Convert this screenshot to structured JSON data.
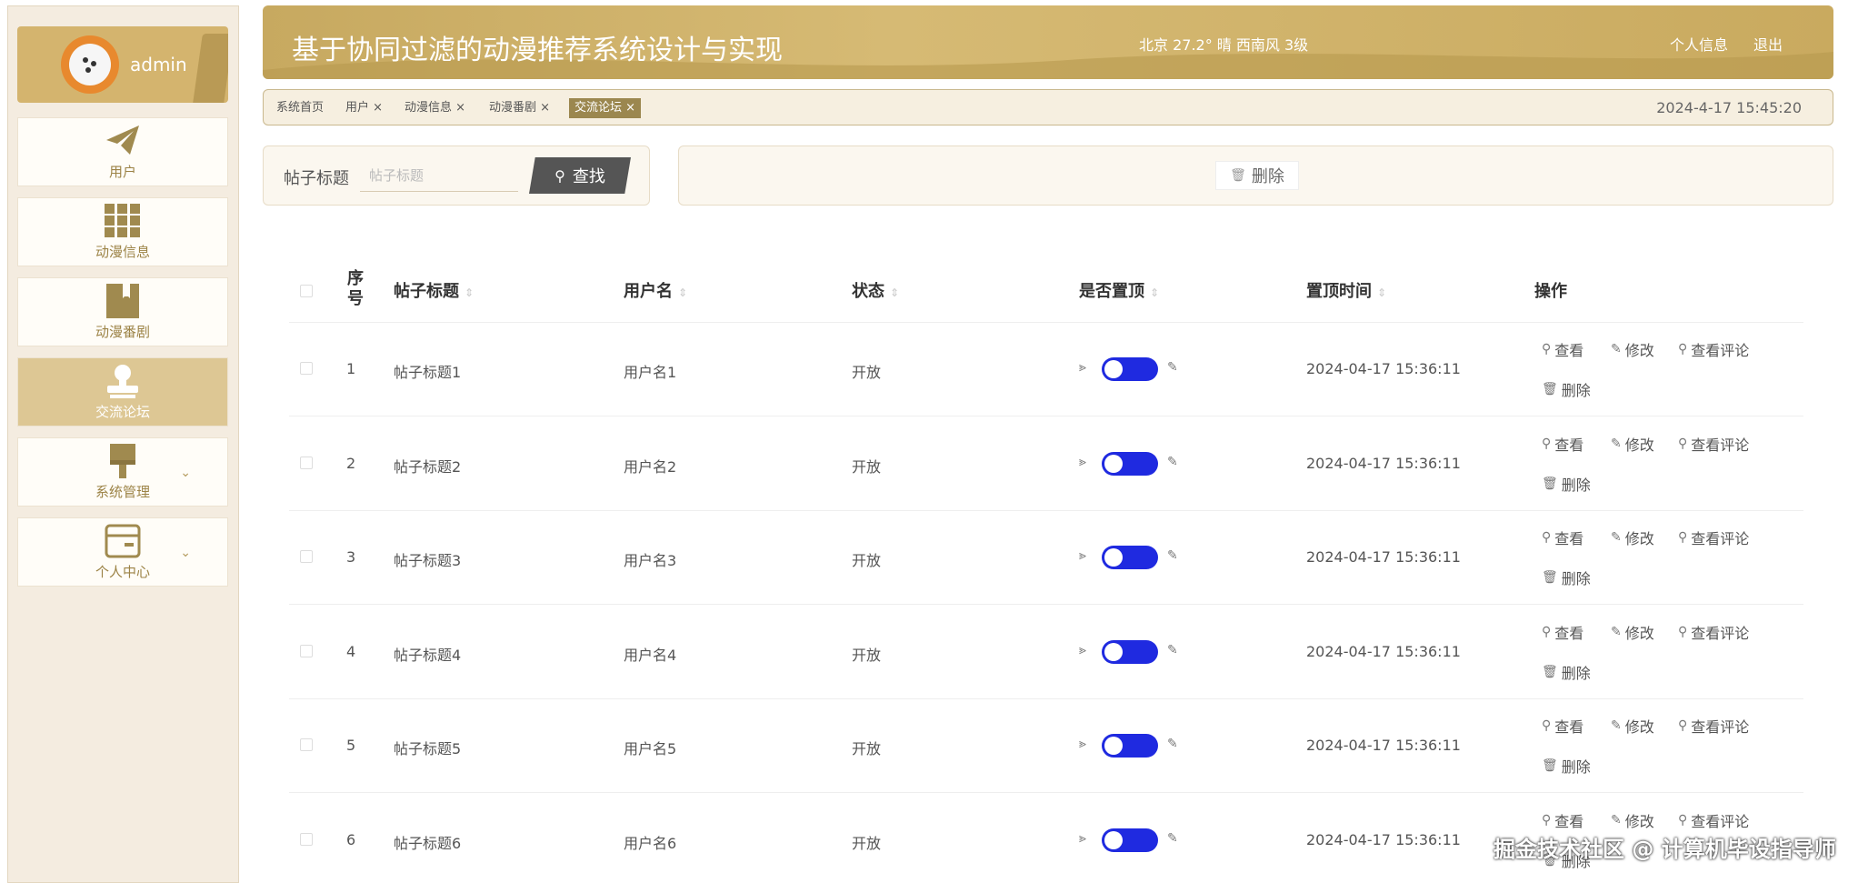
{
  "user": {
    "name": "admin"
  },
  "sidebar": {
    "items": [
      {
        "label": "用户",
        "icon": "paper-plane-icon"
      },
      {
        "label": "动漫信息",
        "icon": "grid-icon"
      },
      {
        "label": "动漫番剧",
        "icon": "book-icon"
      },
      {
        "label": "交流论坛",
        "icon": "stamp-icon",
        "active": true
      },
      {
        "label": "系统管理",
        "icon": "brush-icon"
      },
      {
        "label": "个人中心",
        "icon": "wallet-icon"
      }
    ]
  },
  "header": {
    "title": "基于协同过滤的动漫推荐系统设计与实现",
    "weather": "北京  27.2°  晴  西南风  3级",
    "profile_link": "个人信息",
    "logout_link": "退出"
  },
  "tabs": [
    {
      "label": "系统首页"
    },
    {
      "label": "用户 ×"
    },
    {
      "label": "动漫信息 ×"
    },
    {
      "label": "动漫番剧 ×"
    },
    {
      "label": "交流论坛 ×",
      "active": true
    }
  ],
  "datetime": "2024-4-17 15:45:20",
  "search": {
    "label": "帖子标题",
    "placeholder": "帖子标题",
    "button": "查找"
  },
  "toolbar": {
    "delete_label": "删除"
  },
  "table": {
    "headers": {
      "seq": "序号",
      "title": "帖子标题",
      "user": "用户名",
      "status": "状态",
      "pinned": "是否置顶",
      "pin_time": "置顶时间",
      "ops": "操作"
    },
    "actions": {
      "view": "查看",
      "edit": "修改",
      "comments": "查看评论",
      "delete": "删除"
    },
    "rows": [
      {
        "seq": "1",
        "title": "帖子标题1",
        "user": "用户名1",
        "status": "开放",
        "pin_time": "2024-04-17 15:36:11"
      },
      {
        "seq": "2",
        "title": "帖子标题2",
        "user": "用户名2",
        "status": "开放",
        "pin_time": "2024-04-17 15:36:11"
      },
      {
        "seq": "3",
        "title": "帖子标题3",
        "user": "用户名3",
        "status": "开放",
        "pin_time": "2024-04-17 15:36:11"
      },
      {
        "seq": "4",
        "title": "帖子标题4",
        "user": "用户名4",
        "status": "开放",
        "pin_time": "2024-04-17 15:36:11"
      },
      {
        "seq": "5",
        "title": "帖子标题5",
        "user": "用户名5",
        "status": "开放",
        "pin_time": "2024-04-17 15:36:11"
      },
      {
        "seq": "6",
        "title": "帖子标题6",
        "user": "用户名6",
        "status": "开放",
        "pin_time": "2024-04-17 15:36:11"
      }
    ]
  },
  "watermark": "掘金技术社区 @ 计算机毕设指导师",
  "colors": {
    "accent": "#d4b46e",
    "toggle_on": "#1f2ae0",
    "header": "#c7a960"
  }
}
